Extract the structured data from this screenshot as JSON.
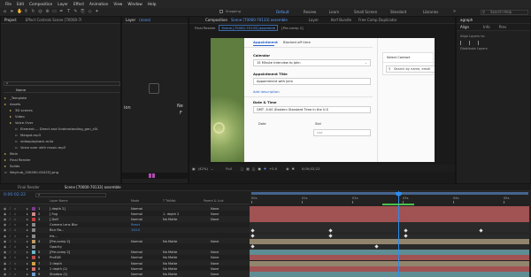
{
  "menu": [
    "File",
    "Edit",
    "Composition",
    "Layer",
    "Effect",
    "Animation",
    "View",
    "Window",
    "Help"
  ],
  "toolbar": {
    "snapping": "Snapping",
    "workspaces": [
      "Default",
      "Review",
      "Learn",
      "Small Screen",
      "Standard",
      "Libraries"
    ],
    "active_workspace": "Default",
    "search_placeholder": "Search Help"
  },
  "project_panel": {
    "tabs": [
      "Project",
      "Effect Controls Scene [70000-7I",
      "Layer",
      "(none)"
    ],
    "search_placeholder": "ρ",
    "column_header": "Name",
    "items": [
      {
        "label": "_Template",
        "depth": 0,
        "type": "folder"
      },
      {
        "label": "Assets",
        "depth": 0,
        "type": "folder"
      },
      {
        "label": "3D scenes",
        "depth": 1,
        "type": "folder"
      },
      {
        "label": "Video",
        "depth": 1,
        "type": "folder"
      },
      {
        "label": "Voice Over",
        "depth": 1,
        "type": "folder"
      },
      {
        "label": "Element.... Direct and Understanding_gen_s5l.",
        "depth": 2,
        "type": "file"
      },
      {
        "label": "Margot.mp3",
        "depth": 2,
        "type": "file"
      },
      {
        "label": "videoplayback.m4a",
        "depth": 2,
        "type": "file"
      },
      {
        "label": "Voice over with music.mp3",
        "depth": 2,
        "type": "file"
      },
      {
        "label": "Main",
        "depth": 0,
        "type": "folder"
      },
      {
        "label": "Final Render",
        "depth": 0,
        "type": "folder"
      },
      {
        "label": "Solids",
        "depth": 0,
        "type": "folder"
      },
      {
        "label": "Wayhub_200090-00425].png",
        "depth": 0,
        "type": "file"
      }
    ]
  },
  "layer_panel": {
    "labels": [
      "ion",
      "Ne",
      "F"
    ]
  },
  "comp_panel": {
    "tabs": [
      "Composition",
      "Scene [70000-70133] assemble",
      "Layer",
      "Kerf Bundle",
      "Free Comp Duplicator"
    ],
    "sub_tabs": [
      "Final Render",
      "Scene [70000-70133] assemble",
      "[Pre-comp 2]"
    ],
    "zoom": "(42%)",
    "resolution": "Full",
    "timecode": "0;00;02;22"
  },
  "viewer": {
    "tabs": [
      "Appointment",
      "Blocked off time"
    ],
    "calendar_label": "Calendar",
    "calendar_value": "15 Minute Interview to John",
    "title_label": "Appointment Title",
    "title_value": "Appointment with John",
    "add_description": "Add description",
    "datetime_label": "Date & Time",
    "timezone_value": "GMT -5:00 (Eastern Standard Time in the U.S",
    "date_label": "Date",
    "slot_label": "Slot",
    "slot_value": "slot",
    "contact_label": "Select Contact",
    "contact_search_placeholder": "Search by name, email"
  },
  "right_panel": {
    "tabs": [
      "Align",
      "Info",
      "Prev"
    ],
    "paragraph_tab": "agraph",
    "align_to": "Align Layers to:",
    "distribute": "Distribute Layers"
  },
  "timeline": {
    "tabs": [
      "Final Render",
      "Scene [70000-70133] assemble"
    ],
    "timecode": "0:00:02:22",
    "search_placeholder": "ρ",
    "columns": [
      "Layer Name",
      "Mode",
      "T TrkMat",
      "Parent & Link"
    ],
    "ruler": [
      "00s",
      "01s",
      "02s",
      "03s",
      "04s",
      "05s"
    ],
    "layers": [
      {
        "num": "1",
        "name": "[ depth 2]",
        "mode": "Normal",
        "trkmat": "",
        "parent": "None",
        "color": "#7a3c8a"
      },
      {
        "num": "2",
        "name": "[ Fog",
        "mode": "Normal",
        "trkmat": "1. depth 2",
        "parent": "None",
        "color": "#d08a8a"
      },
      {
        "num": "3",
        "name": "[ Dolf",
        "mode": "Normal",
        "trkmat": "No Matte",
        "parent": "None",
        "color": "#c04040"
      },
      {
        "num": "",
        "name": "Camera Lens Blur",
        "mode": "Reset",
        "trkmat": "",
        "parent": "",
        "color": "#888888"
      },
      {
        "num": "",
        "name": "Blur Ra...",
        "mode": "140.0",
        "trkmat": "",
        "parent": "",
        "color": "#888888"
      },
      {
        "num": "",
        "name": "Iris...",
        "mode": "",
        "trkmat": "",
        "parent": "",
        "color": "#888888"
      },
      {
        "num": "4",
        "name": "[Pre-comp 2]",
        "mode": "Normal",
        "trkmat": "No Matte",
        "parent": "None",
        "color": "#c09a60"
      },
      {
        "num": "",
        "name": "Opacity",
        "mode": "",
        "trkmat": "",
        "parent": "",
        "color": "#888888"
      },
      {
        "num": "5",
        "name": "[Pre-comp 2]",
        "mode": "Normal",
        "trkmat": "No Matte",
        "parent": "None",
        "color": "#6ab8c8"
      },
      {
        "num": "6",
        "name": "ProEX8",
        "mode": "Normal",
        "trkmat": "No Matte",
        "parent": "None",
        "color": "#b84c4c"
      },
      {
        "num": "7",
        "name": "2 depth",
        "mode": "Normal",
        "trkmat": "No Matte",
        "parent": "None",
        "color": "#d0a040"
      },
      {
        "num": "8",
        "name": "2 depth (2)",
        "mode": "Normal",
        "trkmat": "No Matte",
        "parent": "None",
        "color": "#d07070"
      },
      {
        "num": "9",
        "name": "Shadow (1)",
        "mode": "Normal",
        "trkmat": "No Matte",
        "parent": "None",
        "color": "#6a9ad0"
      }
    ]
  },
  "colors": {
    "accent": "#2d8ceb",
    "work_area": "#4a6fa5",
    "bar_red": "#b75b5b",
    "bar_tan": "#a6977a",
    "bar_teal": "#6aa0a8"
  }
}
